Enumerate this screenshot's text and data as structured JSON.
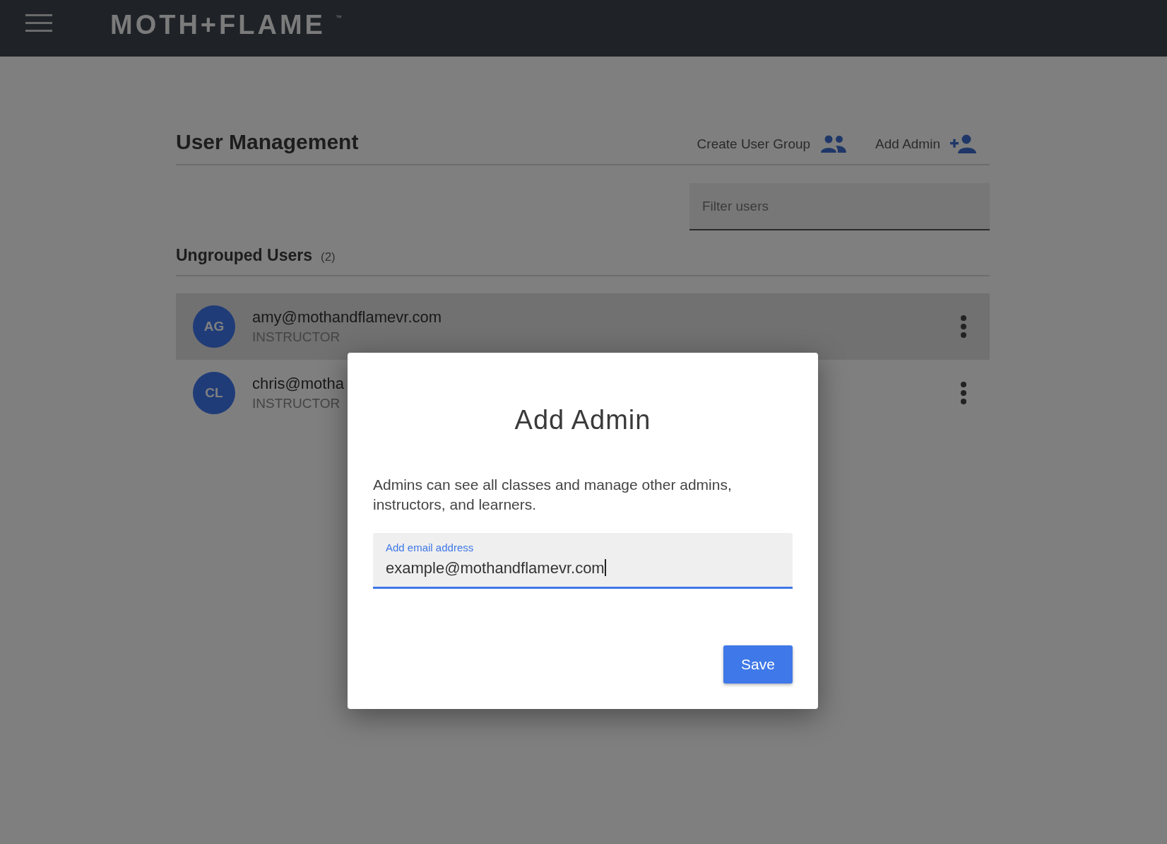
{
  "header": {
    "logo": "MOTH+FLAME",
    "trademark": "™"
  },
  "page": {
    "title": "User Management",
    "actions": [
      {
        "label": "Create User Group",
        "kind": "group"
      },
      {
        "label": "Add Admin",
        "kind": "add-person"
      }
    ],
    "filter": {
      "placeholder": "Filter users"
    }
  },
  "section": {
    "title": "Ungrouped Users",
    "count": "(2)"
  },
  "users": [
    {
      "initials": "AG",
      "email": "amy@mothandflamevr.com",
      "role": "INSTRUCTOR",
      "selected": true
    },
    {
      "initials": "CL",
      "email": "chris@motha",
      "role": "INSTRUCTOR",
      "selected": false
    }
  ],
  "dialog": {
    "title": "Add Admin",
    "description": "Admins can see all classes and manage other admins, instructors, and learners.",
    "field": {
      "label": "Add email address",
      "value": "example@mothandflamevr.com"
    },
    "button": "Save"
  }
}
